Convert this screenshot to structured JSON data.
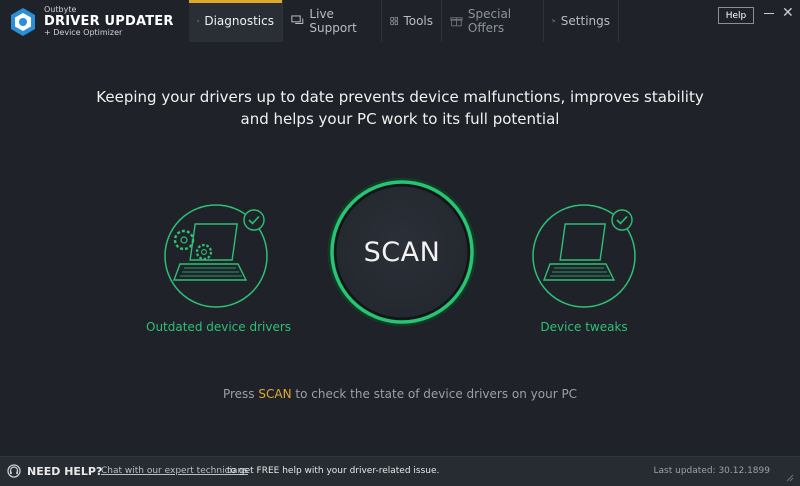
{
  "app": {
    "brand_small": "Outbyte",
    "brand_big": "DRIVER UPDATER",
    "brand_sub": "+ Device Optimizer"
  },
  "tabs": [
    {
      "label": "Diagnostics",
      "icon": "gear-icon"
    },
    {
      "label": "Live Support",
      "icon": "chat-icon"
    },
    {
      "label": "Tools",
      "icon": "grid-icon"
    },
    {
      "label": "Special Offers",
      "icon": "gift-icon"
    },
    {
      "label": "Settings",
      "icon": "wrench-icon"
    }
  ],
  "window": {
    "help_label": "Help",
    "close_glyph": "✕"
  },
  "main": {
    "headline_line1": "Keeping your drivers up to date prevents device malfunctions, improves stability",
    "headline_line2": "and helps your PC work to its full potential",
    "left_label": "Outdated device drivers",
    "right_label": "Device tweaks",
    "scan_label": "SCAN",
    "hint_before": "Press",
    "hint_highlight": "SCAN",
    "hint_after": "to check the state of device drivers on your PC"
  },
  "footer": {
    "need_help": "NEED HELP?",
    "link_text": "Chat with our expert technicians",
    "rest_text": "to get FREE help with your driver-related issue.",
    "last_updated": "Last updated: 30.12.1899"
  },
  "colors": {
    "background": "#1f2329",
    "accent_green": "#2fbf75",
    "accent_orange": "#e0a92e"
  }
}
